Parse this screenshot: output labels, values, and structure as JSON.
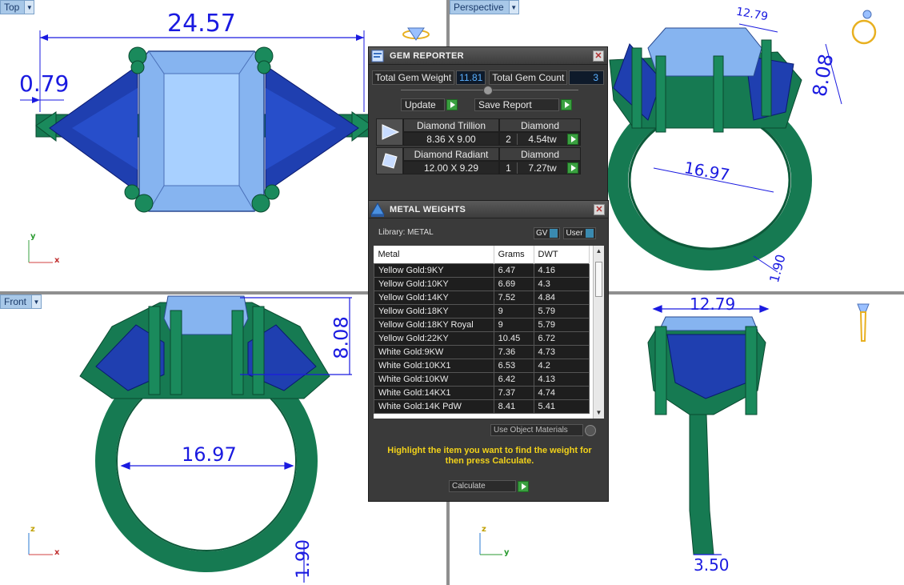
{
  "viewports": {
    "top": {
      "label": "Top",
      "dims": [
        "24.57",
        "0.79"
      ],
      "axes": [
        "y",
        "x"
      ]
    },
    "perspective": {
      "label": "Perspective",
      "dims": [
        "12.79",
        "8.08",
        "16.97",
        "1.90"
      ]
    },
    "front": {
      "label": "Front",
      "dims": [
        "8.08",
        "16.97",
        "1.90"
      ],
      "axes": [
        "z",
        "x"
      ]
    },
    "right": {
      "dims": [
        "12.79",
        "3.50"
      ],
      "axes": [
        "z",
        "y"
      ]
    }
  },
  "gem_reporter": {
    "title": "GEM REPORTER",
    "total_weight_label": "Total Gem Weight",
    "total_weight_value": "11.81",
    "total_count_label": "Total Gem Count",
    "total_count_value": "3",
    "update_label": "Update",
    "save_label": "Save Report",
    "gems": [
      {
        "name": "Diamond Trillion",
        "type": "Diamond",
        "size": "8.36 X 9.00",
        "count": "2",
        "weight": "4.54tw"
      },
      {
        "name": "Diamond Radiant",
        "type": "Diamond",
        "size": "12.00 X 9.29",
        "count": "1",
        "weight": "7.27tw"
      }
    ]
  },
  "metal_weights": {
    "title": "METAL WEIGHTS",
    "library_label": "Library:  METAL",
    "gv_label": "GV",
    "user_label": "User",
    "columns": [
      "Metal",
      "Grams",
      "DWT"
    ],
    "rows": [
      [
        "Yellow Gold:9KY",
        "6.47",
        "4.16"
      ],
      [
        "Yellow Gold:10KY",
        "6.69",
        "4.3"
      ],
      [
        "Yellow Gold:14KY",
        "7.52",
        "4.84"
      ],
      [
        "Yellow Gold:18KY",
        "9",
        "5.79"
      ],
      [
        "Yellow Gold:18KY Royal",
        "9",
        "5.79"
      ],
      [
        "Yellow Gold:22KY",
        "10.45",
        "6.72"
      ],
      [
        "White Gold:9KW",
        "7.36",
        "4.73"
      ],
      [
        "White Gold:10KX1",
        "6.53",
        "4.2"
      ],
      [
        "White Gold:10KW",
        "6.42",
        "4.13"
      ],
      [
        "White Gold:14KX1",
        "7.37",
        "4.74"
      ],
      [
        "White Gold:14K PdW",
        "8.41",
        "5.41"
      ]
    ],
    "use_object_materials": "Use Object Materials",
    "hint": "Highlight the item you want to find the weight for then press Calculate.",
    "calculate_label": "Calculate"
  },
  "colors": {
    "metal": "#167a52",
    "gem_center": "#86b4f0",
    "gem_side": "#1f3fb0",
    "dimension": "#1a1ae0",
    "hint_text": "#f2d21a"
  }
}
